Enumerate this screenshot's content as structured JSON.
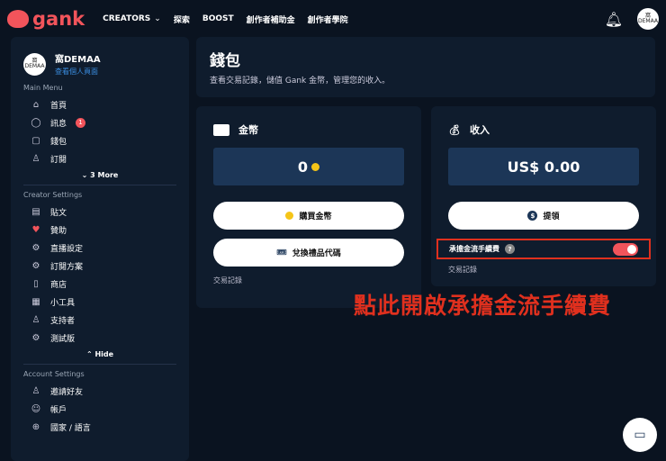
{
  "nav": {
    "logo": "gank",
    "items": [
      "CREATORS",
      "探索",
      "BOOST",
      "創作者補助金",
      "創作者學院"
    ],
    "avatar": "窩 DEMAA"
  },
  "sidebar": {
    "name": "窩DEMAA",
    "link": "查看個人頁面",
    "main_menu": "Main Menu",
    "main": [
      {
        "label": "首頁",
        "icon": "⌂"
      },
      {
        "label": "訊息",
        "icon": "◯",
        "badge": "1"
      },
      {
        "label": "錢包",
        "icon": "▢"
      },
      {
        "label": "訂閱",
        "icon": "♙"
      }
    ],
    "more": "⌄ 3 More",
    "creator_settings": "Creator Settings",
    "creator": [
      {
        "label": "貼文",
        "icon": "▤"
      },
      {
        "label": "贊助",
        "icon": "♥"
      },
      {
        "label": "直播設定",
        "icon": "⚙"
      },
      {
        "label": "訂閱方案",
        "icon": "⚙"
      },
      {
        "label": "商店",
        "icon": "▯"
      },
      {
        "label": "小工具",
        "icon": "▦"
      },
      {
        "label": "支持者",
        "icon": "♙"
      },
      {
        "label": "測試版",
        "icon": "⚙"
      }
    ],
    "hide": "⌃ Hide",
    "account_settings": "Account Settings",
    "account": [
      {
        "label": "邀請好友",
        "icon": "♙"
      },
      {
        "label": "帳戶",
        "icon": "☺"
      },
      {
        "label": "國家 / 語言",
        "icon": "⊕"
      }
    ]
  },
  "header": {
    "title": "錢包",
    "subtitle": "查看交易記錄，儲值 Gank 金幣，管理您的收入。"
  },
  "coins": {
    "title": "金幣",
    "value": "0",
    "buy": "購買金幣",
    "redeem": "兌換禮品代碼",
    "history": "交易記錄"
  },
  "income": {
    "title": "收入",
    "value": "US$ 0.00",
    "withdraw": "提領",
    "fee_label": "承擔金流手續費",
    "fee_on": true,
    "history": "交易記錄"
  },
  "annotation": "點此開啟承擔金流手續費"
}
